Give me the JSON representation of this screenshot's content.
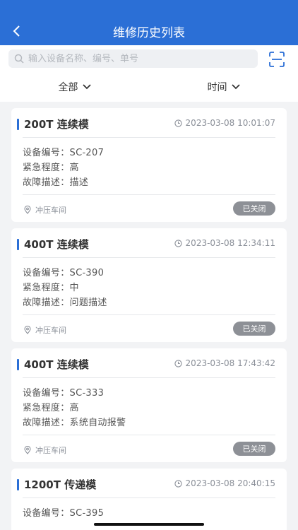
{
  "header": {
    "title": "维修历史列表"
  },
  "search": {
    "placeholder": "输入设备名称、编号、单号"
  },
  "filters": [
    {
      "label": "全部"
    },
    {
      "label": "时间"
    }
  ],
  "labels": {
    "device_no": "设备编号：",
    "urgency": "紧急程度：",
    "fault": "故障描述："
  },
  "records": [
    {
      "title": "200T 连续模",
      "time": "2023-03-08 10:01:07",
      "device_no": "SC-207",
      "urgency": "高",
      "fault": "描述",
      "location": "冲压车间",
      "status": "已关闭"
    },
    {
      "title": "400T 连续模",
      "time": "2023-03-08 12:34:11",
      "device_no": "SC-390",
      "urgency": "中",
      "fault": "问题描述",
      "location": "冲压车间",
      "status": "已关闭"
    },
    {
      "title": "400T 连续模",
      "time": "2023-03-08 17:43:42",
      "device_no": "SC-333",
      "urgency": "高",
      "fault": "系统自动报警",
      "location": "冲压车间",
      "status": "已关闭"
    },
    {
      "title": "1200T 传递模",
      "time": "2023-03-08 20:40:15",
      "device_no": "SC-395"
    }
  ],
  "colors": {
    "primary": "#2b6fd6",
    "status_closed": "#8d9096",
    "page_bg": "#f2f3f5"
  }
}
